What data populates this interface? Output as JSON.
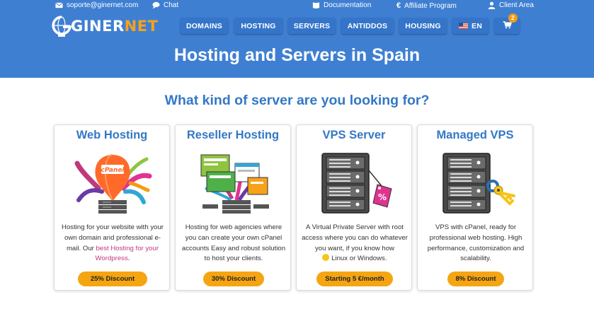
{
  "colors": {
    "header_bg": "#3f7fd2",
    "accent": "#3478c5",
    "button": "#f5a512",
    "logo_net": "#f6a21b",
    "highlight_link": "#c0397a"
  },
  "topbar": {
    "email": {
      "icon": "envelope-icon",
      "text": "soporte@ginernet.com"
    },
    "chat": {
      "icon": "chat-bubble-icon",
      "text": "Chat"
    },
    "docs": {
      "icon": "book-icon",
      "text": "Documentation"
    },
    "affiliate": {
      "icon": "euro-icon",
      "text": "Affiliate Program"
    },
    "client": {
      "icon": "user-icon",
      "text": "Client Area"
    }
  },
  "logo": {
    "part1": "GINER",
    "part2": "NET"
  },
  "nav": {
    "items": [
      "DOMAINS",
      "HOSTING",
      "SERVERS",
      "ANTIDDOS",
      "HOUSING"
    ],
    "language": "EN",
    "cart_count": "2"
  },
  "hero": {
    "title": "Hosting and Servers in Spain"
  },
  "section": {
    "title": "What kind of server are you looking for?"
  },
  "cards": [
    {
      "title": "Web Hosting",
      "desc_pre": "Hosting for your website with your own domain and professional e-mail. Our ",
      "desc_link": "best Hosting for your Wordpress",
      "desc_post": ".",
      "image_label": "cPanel",
      "button": "25% Discount"
    },
    {
      "title": "Reseller Hosting",
      "desc": "Hosting for web agencies where you can create your own cPanel accounts Easy and robust solution to host your clients.",
      "button": "30% Discount"
    },
    {
      "title": "VPS Server",
      "desc_pre": "A Virtual Private Server with root access where you can do whatever you want, if you know how",
      "desc_post": " Linux or Windows.",
      "image_label": "%",
      "button": "Starting 5 €/month"
    },
    {
      "title": "Managed VPS",
      "desc": "VPS with cPanel, ready for professional web hosting. High performance, customization and scalability.",
      "button": "8% Discount"
    }
  ]
}
